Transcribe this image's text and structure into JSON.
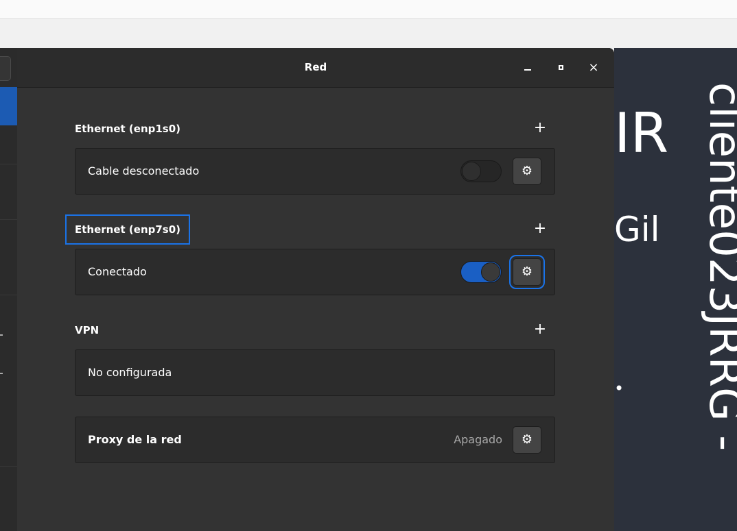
{
  "window": {
    "title": "Red",
    "min_icon": "window-minimize-icon",
    "max_icon": "window-maximize-icon",
    "close_icon": "window-close-icon",
    "close_glyph": "×"
  },
  "sections": {
    "ethernet1": {
      "heading": "Ethernet (enp1s0)",
      "add_glyph": "+",
      "status": "Cable desconectado",
      "switch_on": false,
      "settings_glyph": "⚙"
    },
    "ethernet2": {
      "heading": "Ethernet (enp7s0)",
      "add_glyph": "+",
      "status": "Conectado",
      "switch_on": true,
      "settings_glyph": "⚙"
    },
    "vpn": {
      "heading": "VPN",
      "add_glyph": "+",
      "status": "No configurada"
    },
    "proxy": {
      "label": "Proxy de la red",
      "state": "Apagado",
      "settings_glyph": "⚙"
    }
  },
  "background": {
    "slide_text_large": "IR",
    "slide_text_name": "Gil",
    "slide_vertical": "cliente023JRRG -",
    "slide_dot": "•"
  },
  "colors": {
    "accent": "#1a73e8",
    "switch_on": "#1a5fc4",
    "window_bg": "#333333",
    "row_bg": "#2c2c2c",
    "slide_bg": "#2c313c"
  }
}
